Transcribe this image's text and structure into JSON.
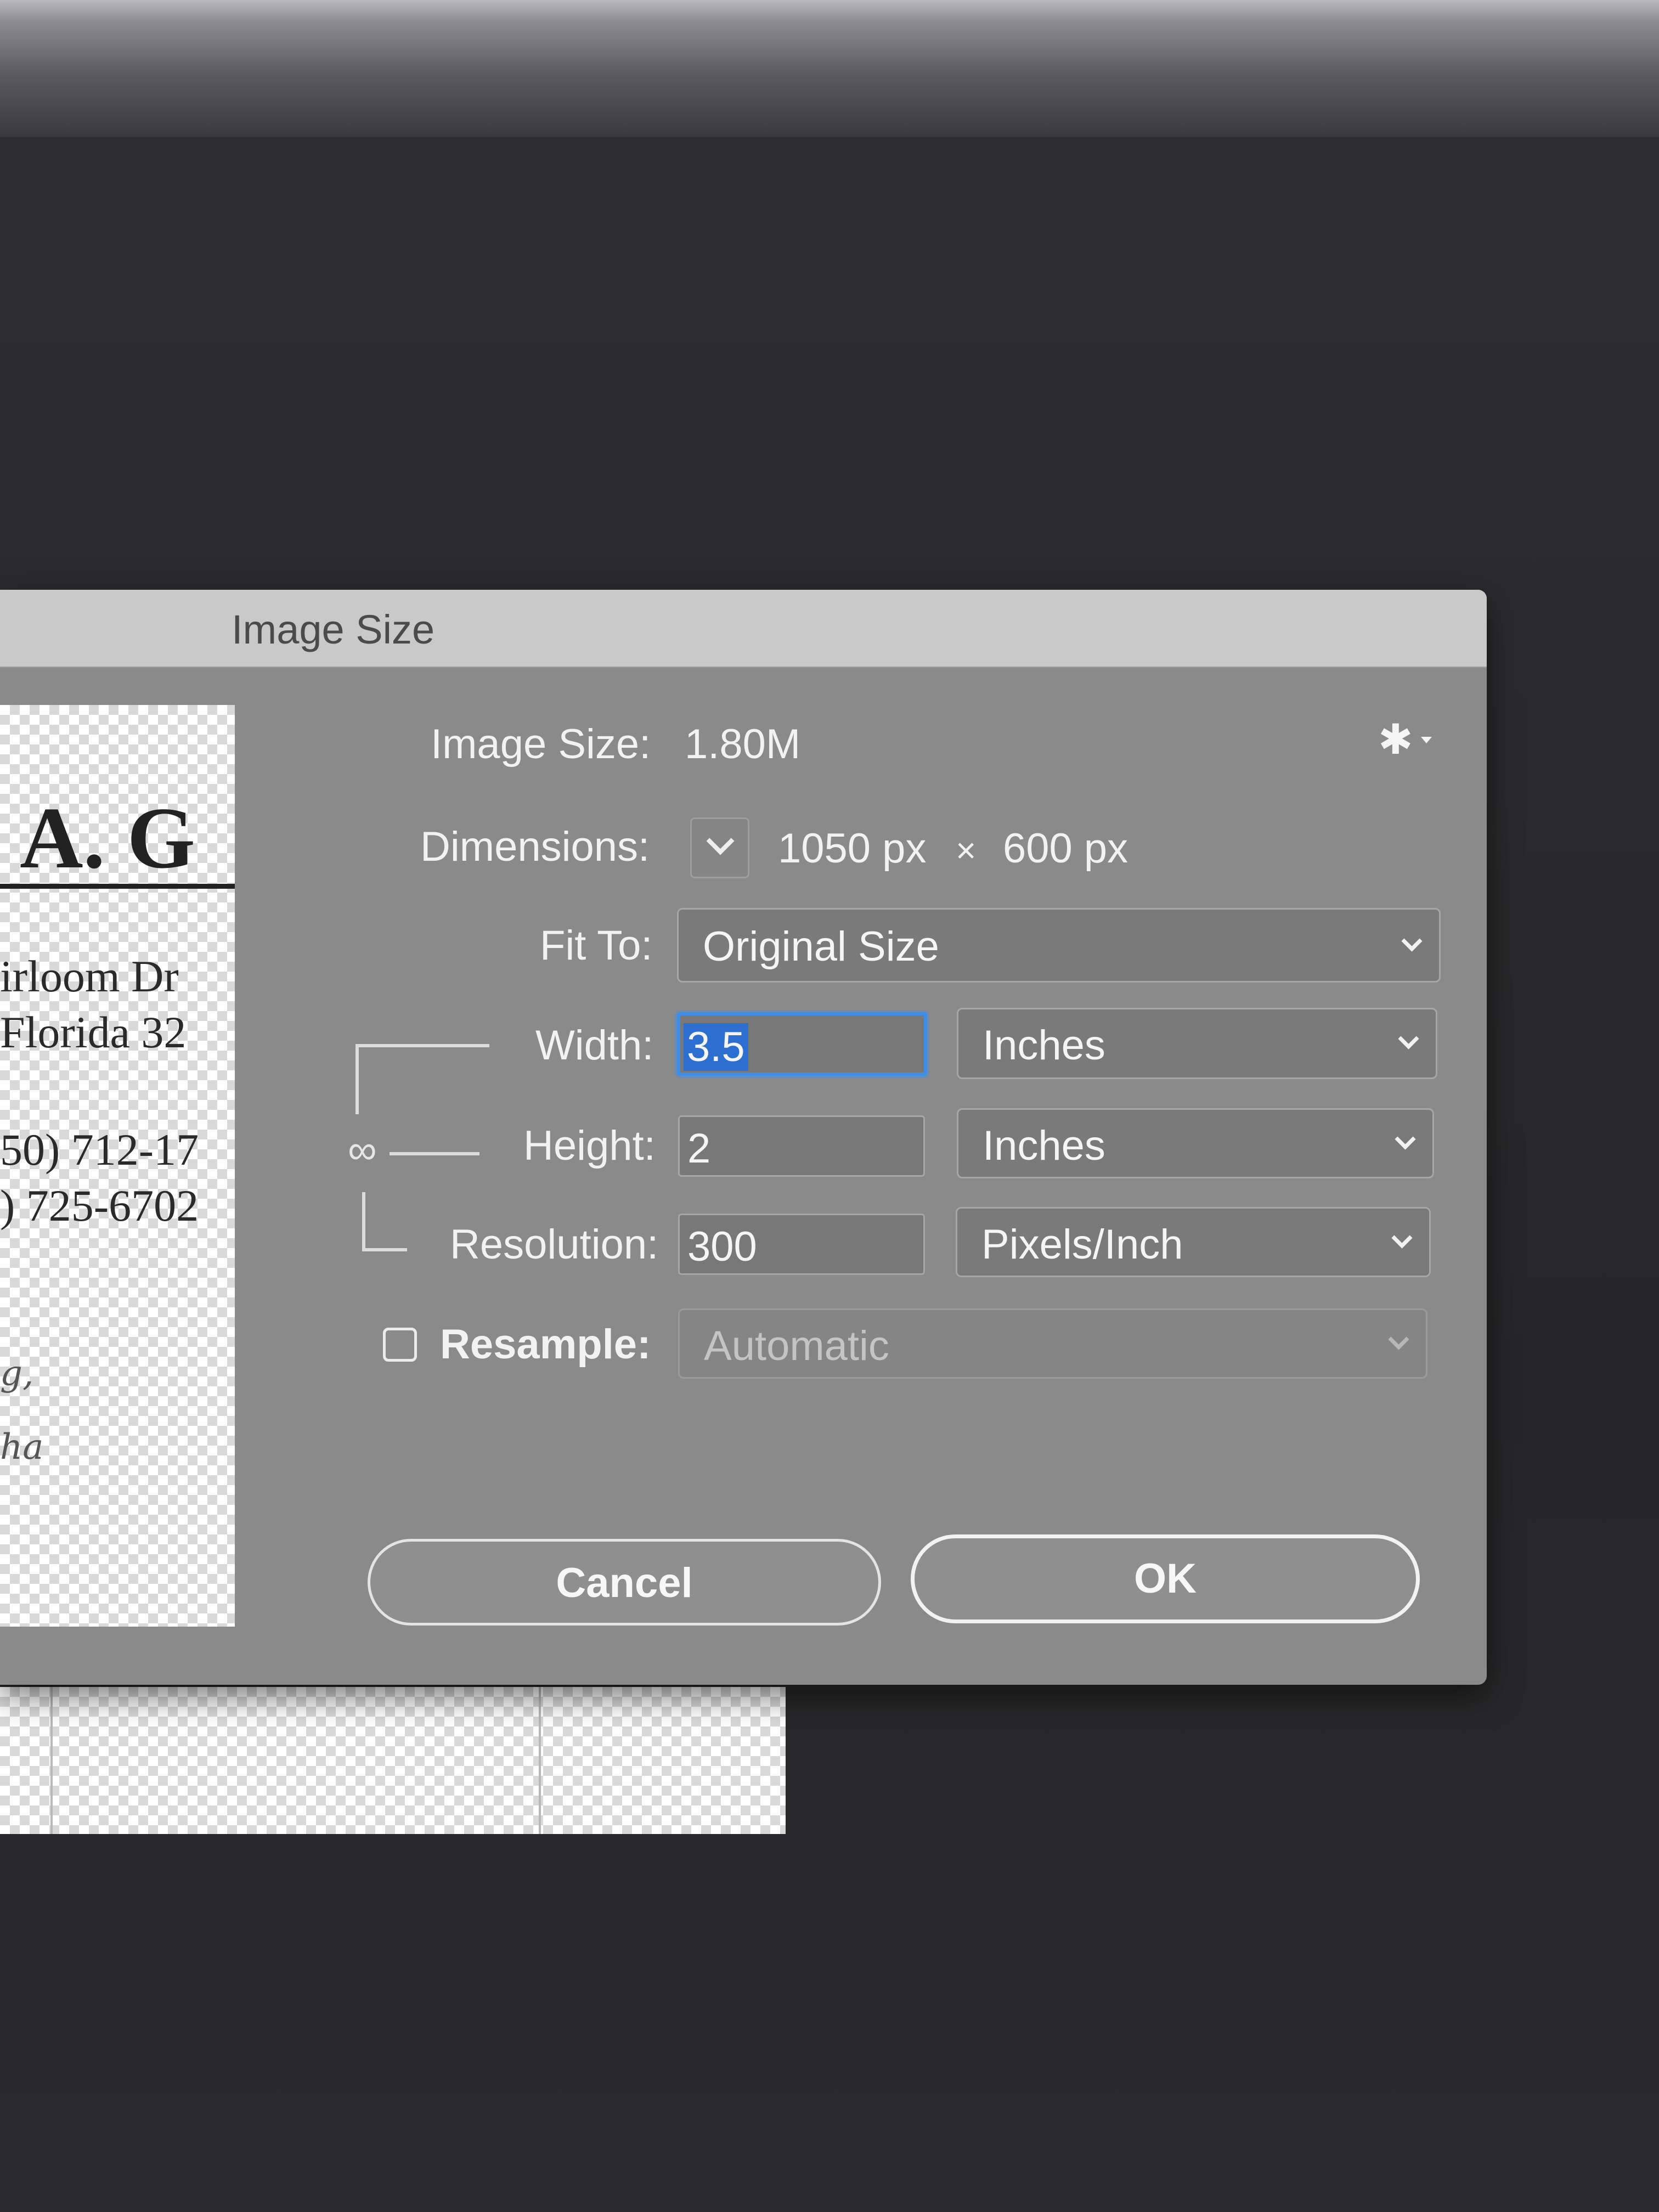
{
  "dialog": {
    "title": "Image Size",
    "image_size_label": "Image Size:",
    "image_size_value": "1.80M",
    "settings_icon": "gear-icon",
    "dimensions_label": "Dimensions:",
    "dimensions_width": "1050 px",
    "dimensions_sep": "×",
    "dimensions_height": "600 px",
    "fit_to_label": "Fit To:",
    "fit_to_value": "Original Size",
    "width_label": "Width:",
    "width_value": "3.5",
    "width_unit": "Inches",
    "height_label": "Height:",
    "height_value": "2",
    "height_unit": "Inches",
    "resolution_label": "Resolution:",
    "resolution_value": "300",
    "resolution_unit": "Pixels/Inch",
    "resample_label": "Resample:",
    "resample_checked": false,
    "resample_value": "Automatic",
    "cancel_label": "Cancel",
    "ok_label": "OK"
  },
  "preview": {
    "name_fragment": "A. G",
    "address_line1": "irloom Dr",
    "address_line2": "Florida 32",
    "phone1": "50) 712-17",
    "phone2": ") 725-6702",
    "script1": "g,",
    "script2": "ha"
  },
  "colors": {
    "dialog_bg": "#8a8a8b",
    "titlebar_bg": "#c9c9c9",
    "focus_ring": "#3d8ee8",
    "screen_bg": "#2b2b2d"
  }
}
